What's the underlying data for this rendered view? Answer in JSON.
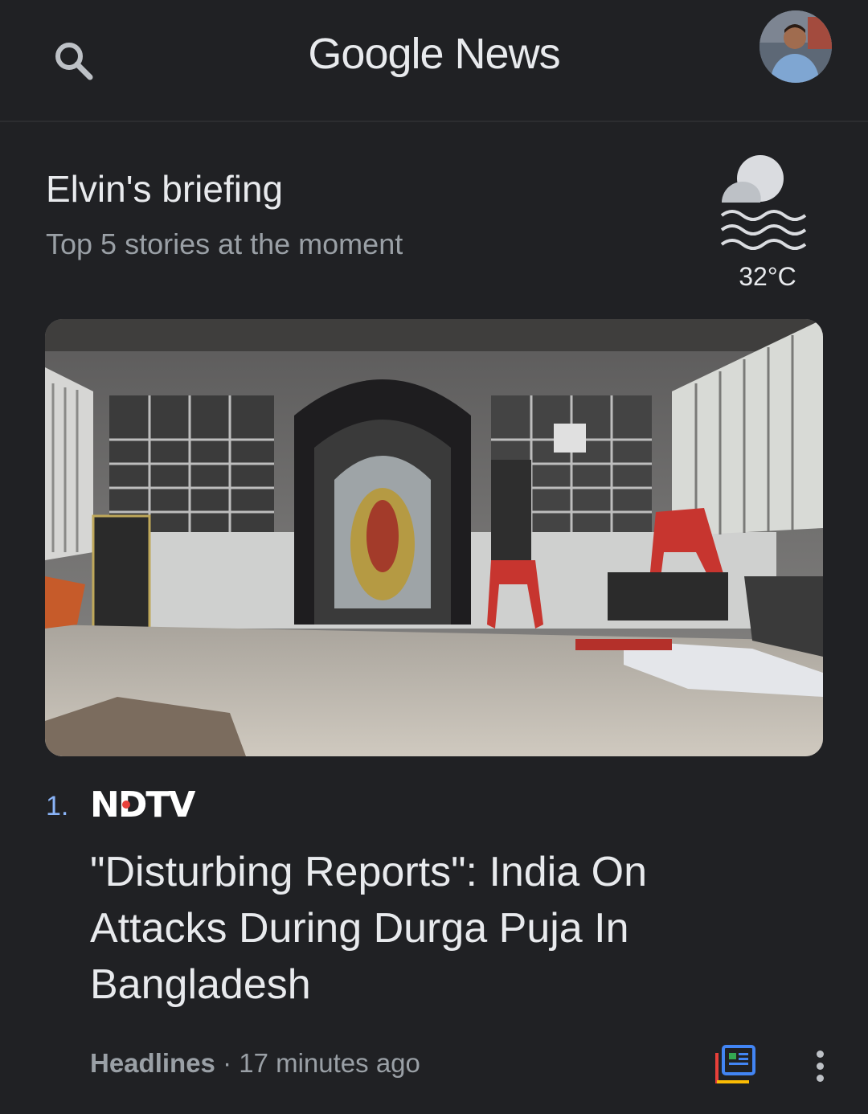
{
  "header": {
    "title": "Google News",
    "search_icon": "search-icon",
    "avatar_icon": "user-avatar"
  },
  "briefing": {
    "title": "Elvin's briefing",
    "subtitle": "Top 5 stories at the moment",
    "weather": {
      "icon": "haze-icon",
      "temperature": "32°C"
    }
  },
  "story": {
    "rank": "1.",
    "source": "NDTV",
    "headline": "\"Disturbing Reports\": India On Attacks During Durga Puja In Bangladesh",
    "category": "Headlines",
    "separator": " · ",
    "time": "17 minutes ago",
    "full_coverage_icon": "full-coverage-icon",
    "more_icon": "more-vert-icon"
  },
  "colors": {
    "background": "#202124",
    "accent": "#8ab4f8",
    "secondary_text": "#9aa0a6",
    "ndtv_red": "#e8403a"
  }
}
